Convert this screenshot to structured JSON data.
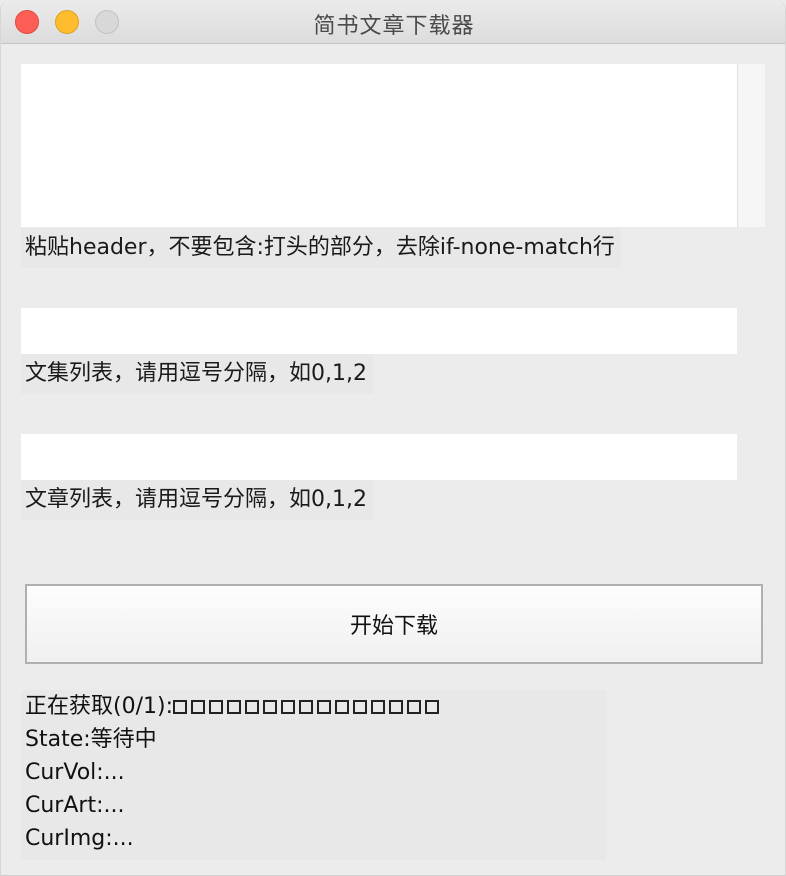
{
  "window": {
    "title": "简书文章下载器"
  },
  "header_section": {
    "header_value": "",
    "label": "粘贴header，不要包含:打头的部分，去除if-none-match行"
  },
  "collections_section": {
    "value": "",
    "label": "文集列表，请用逗号分隔，如0,1,2"
  },
  "articles_section": {
    "value": "",
    "label": "文章列表，请用逗号分隔，如0,1,2"
  },
  "actions": {
    "start_download_label": "开始下载"
  },
  "status": {
    "fetching_label": "正在获取(0/1):",
    "progress_box_count": 15,
    "state_line": "State:等待中",
    "cur_vol_line": "CurVol:...",
    "cur_art_line": "CurArt:...",
    "cur_img_line": "CurImg:..."
  },
  "colors": {
    "close": "#fd5f57",
    "minimize": "#febc2e",
    "zoom_inactive": "#d8d8d8"
  }
}
